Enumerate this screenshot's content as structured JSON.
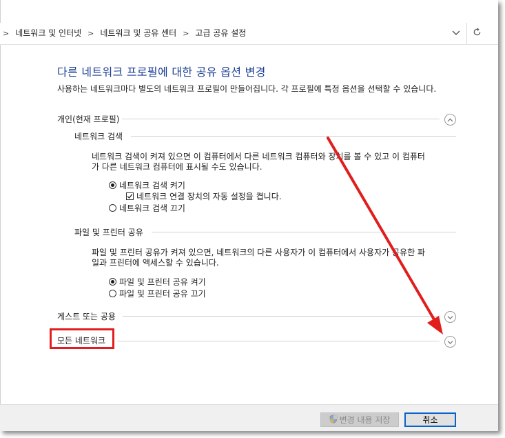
{
  "breadcrumb": {
    "items": [
      "네트워크 및 인터넷",
      "네트워크 및 공유 센터",
      "고급 공유 설정"
    ],
    "separator": ">"
  },
  "page": {
    "title": "다른 네트워크 프로필에 대한 공유 옵션 변경",
    "description": "사용하는 네트워크마다 별도의 네트워크 프로필이 만들어집니다. 각 프로필에 특정 옵션을 선택할 수 있습니다."
  },
  "sections": {
    "private": {
      "label": "개인(현재 프로필)",
      "expanded": true,
      "discovery": {
        "label": "네트워크 검색",
        "text_line1": "네트워크 검색이 켜져 있으면 이 컴퓨터에서 다른 네트워크 컴퓨터와 장치를 볼 수 있고 이 컴퓨터",
        "text_line2": "가 다른 네트워크 컴퓨터에 표시될 수도 있습니다.",
        "option_on": "네트워크 검색 켜기",
        "option_on_selected": true,
        "auto_setup": "네트워크 연결 장치의 자동 설정을 켭니다.",
        "auto_setup_checked": true,
        "option_off": "네트워크 검색 끄기"
      },
      "file_sharing": {
        "label": "파일 및 프린터 공유",
        "text_line1": "파일 및 프린터 공유가 켜져 있으면, 네트워크의 다른 사용자가 이 컴퓨터에서 사용자가 공유한 파",
        "text_line2": "일과 프린터에 액세스할 수 있습니다.",
        "option_on": "파일 및 프린터 공유 켜기",
        "option_on_selected": true,
        "option_off": "파일 및 프린터 공유 끄기"
      }
    },
    "guest": {
      "label": "게스트 또는 공용",
      "expanded": false
    },
    "all": {
      "label": "모든 네트워크",
      "expanded": false
    }
  },
  "footer": {
    "save_label": "변경 내용 저장",
    "save_enabled": false,
    "cancel_label": "취소"
  },
  "colors": {
    "title": "#1c3f94",
    "annotation_red": "#e11d1d",
    "cancel_border": "#0a62c9"
  },
  "icons": {
    "address_dropdown": "chevron-down-icon",
    "refresh": "refresh-icon",
    "section_collapse": "chevron-up-circle-icon",
    "section_expand": "chevron-down-circle-icon",
    "save_button": "uac-shield-icon"
  }
}
